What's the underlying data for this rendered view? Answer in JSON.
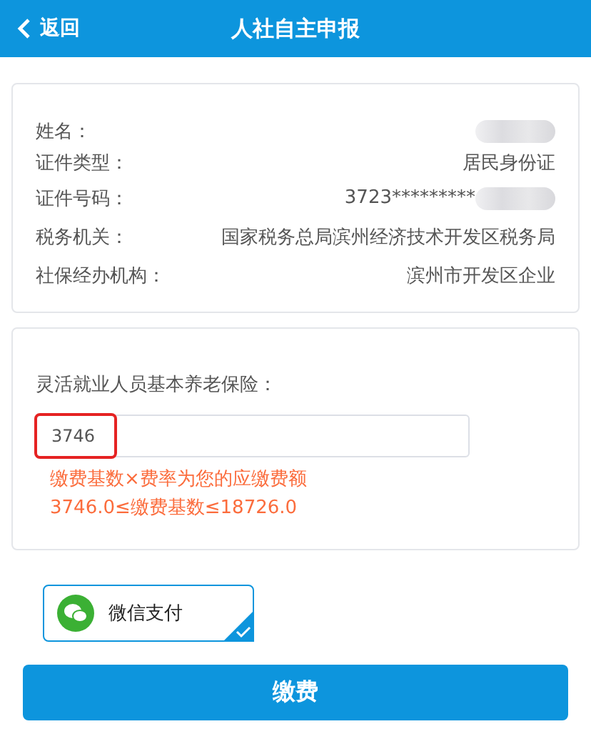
{
  "header": {
    "back": "返回",
    "title": "人社自主申报"
  },
  "info": [
    {
      "label": "姓名：",
      "kind": "blurred"
    },
    {
      "label": "证件类型：",
      "value": "居民身份证",
      "kind": "text"
    },
    {
      "label": "证件号码：",
      "value": "3723*********",
      "kind": "partly-blurred"
    },
    {
      "label": "税务机关：",
      "value": "国家税务总局滨州经济技术开发区税务局",
      "kind": "text"
    },
    {
      "label": "社保经办机构：",
      "value": "滨州市开发区企业",
      "kind": "text"
    }
  ],
  "insurance": {
    "label": "灵活就业人员基本养老保险：",
    "value": "3746",
    "highlighted": true,
    "hints": [
      "缴费基数×费率为您的应缴费额",
      "3746.0≤缴费基数≤18726.0"
    ]
  },
  "payment_methods": [
    {
      "label": "微信支付",
      "selected": true
    }
  ],
  "submit": "缴费"
}
